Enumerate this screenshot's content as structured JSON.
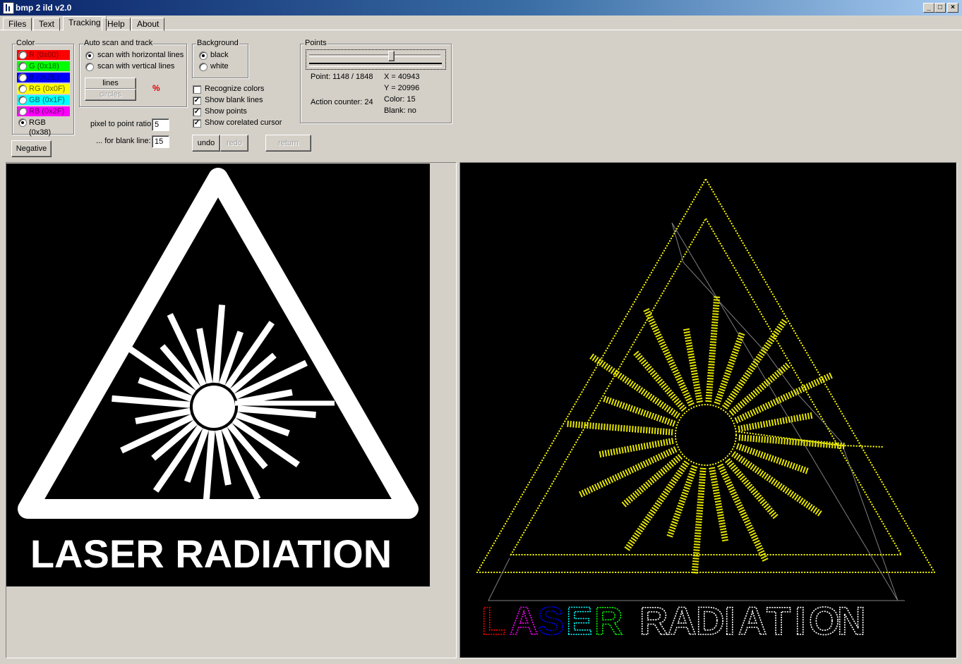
{
  "window": {
    "title": "bmp 2 ild v2.0",
    "min": "_",
    "max": "□",
    "close": "×"
  },
  "tabs": [
    "Files",
    "Text",
    "Tracking",
    "Help",
    "About"
  ],
  "color_group": {
    "label": "Color",
    "options": [
      {
        "label": "R (0x00)",
        "bg": "#ff0000",
        "fg": "#800000"
      },
      {
        "label": "G (0x18)",
        "bg": "#00ff00",
        "fg": "#006000"
      },
      {
        "label": "B (0x2E)",
        "bg": "#0000ff",
        "fg": "#000080"
      },
      {
        "label": "RG (0x0F)",
        "bg": "#ffff00",
        "fg": "#606000"
      },
      {
        "label": "GB (0x1F)",
        "bg": "#00ffff",
        "fg": "#006060"
      },
      {
        "label": "RB (0x2F)",
        "bg": "#ff00ff",
        "fg": "#600060"
      },
      {
        "label": "RGB (0x38)",
        "bg": "#d4d0c8",
        "fg": "#000000"
      }
    ]
  },
  "negative_button": "Negative",
  "autoscan": {
    "label": "Auto scan and track",
    "horizontal": "scan with horizontal lines",
    "vertical": "scan with vertical lines",
    "lines_button": "lines",
    "circles_button": "circles",
    "percent": "%"
  },
  "ratio": {
    "label": "pixel to point ratio:",
    "value": "5",
    "blank_label": "... for blank line:",
    "blank_value": "15"
  },
  "background": {
    "label": "Background",
    "black": "black",
    "white": "white"
  },
  "checkboxes": [
    "Recognize colors",
    "Show blank lines",
    "Show points",
    "Show corelated cursor"
  ],
  "checked": [
    false,
    true,
    true,
    true
  ],
  "undo": "undo",
  "redo": "redo",
  "return": "return",
  "points": {
    "label": "Points",
    "slider_fraction": 0.62,
    "point": "Point: 1148 / 1848",
    "action_counter": "Action counter: 24",
    "x": "X = 40943",
    "y": "Y = 20996",
    "color": "Color: 15",
    "blank": "Blank: no"
  },
  "left_image": {
    "caption": "LASER RADIATION"
  },
  "right_image": {
    "caption_letters": [
      "L",
      "A",
      "S",
      "E",
      "R",
      " ",
      "R",
      "A",
      "D",
      "I",
      "A",
      "T",
      "I",
      "O",
      "N"
    ],
    "letter_colors": [
      "#ff0000",
      "#ff00ff",
      "#0000ff",
      "#00ffff",
      "#00ff00",
      "",
      "#ffffff",
      "#ffffff",
      "#ffffff",
      "#ffffff",
      "#ffffff",
      "#ffffff",
      "#ffffff",
      "#ffffff",
      "#ffffff"
    ],
    "outline_color": "#ffff00"
  }
}
